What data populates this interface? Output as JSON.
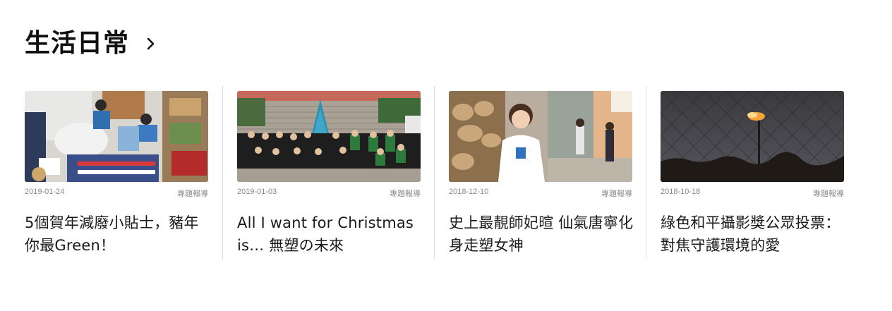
{
  "section": {
    "title": "生活日常",
    "more_icon": "chevron-right-icon"
  },
  "cards": [
    {
      "date": "2019-01-24",
      "category": "專題報導",
      "title": "5個賀年減廢小貼士，豬年你最Green！"
    },
    {
      "date": "2019-01-03",
      "category": "專題報導",
      "title": "All I want for Christmas is… 無塑の未來"
    },
    {
      "date": "2018-12-10",
      "category": "專題報導",
      "title": "史上最靚師妃暄 仙氣唐寧化身走塑女神"
    },
    {
      "date": "2018-10-18",
      "category": "專題報導",
      "title": "綠色和平攝影獎公眾投票：對焦守護環境的愛"
    }
  ]
}
